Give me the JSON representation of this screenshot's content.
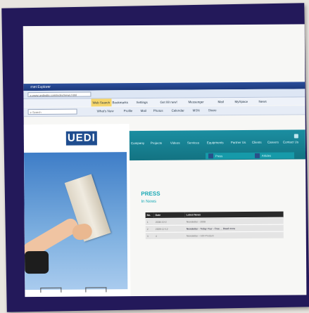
{
  "window": {
    "title_fragment": "rnet Explorer",
    "address": "a.www.uedindia.com/index/news.html"
  },
  "toolbar1": {
    "items": [
      "Web Search",
      "Bookmarks",
      "Settings",
      "Get 88 new!",
      "Messenger",
      "Mail",
      "MySpace",
      "News"
    ]
  },
  "toolbar2": {
    "search_placeholder": "e Search",
    "links": [
      "What's New",
      "Profile",
      "Mail",
      "Photos",
      "Calendar",
      "MSN",
      "Share"
    ]
  },
  "site": {
    "logo": "UEDI",
    "nav": [
      "Company",
      "Projects",
      "Videos",
      "Services",
      "Equipments",
      "Partner Us",
      "Clients",
      "Careers",
      "Contact Us"
    ],
    "subnav": [
      "Press",
      "Articles"
    ],
    "heading": "PRESS",
    "subheading": "In News",
    "table": {
      "headers": [
        "No.",
        "Date",
        "Latest News"
      ],
      "rows": [
        [
          "1",
          "2008-10-2",
          "Newsletter - 2008"
        ],
        [
          "2",
          "2009-12-12",
          "Newsletter - Today Your - Free ... Read more"
        ],
        [
          "3",
          "4",
          "Newsletter - UDI Product"
        ]
      ]
    }
  }
}
